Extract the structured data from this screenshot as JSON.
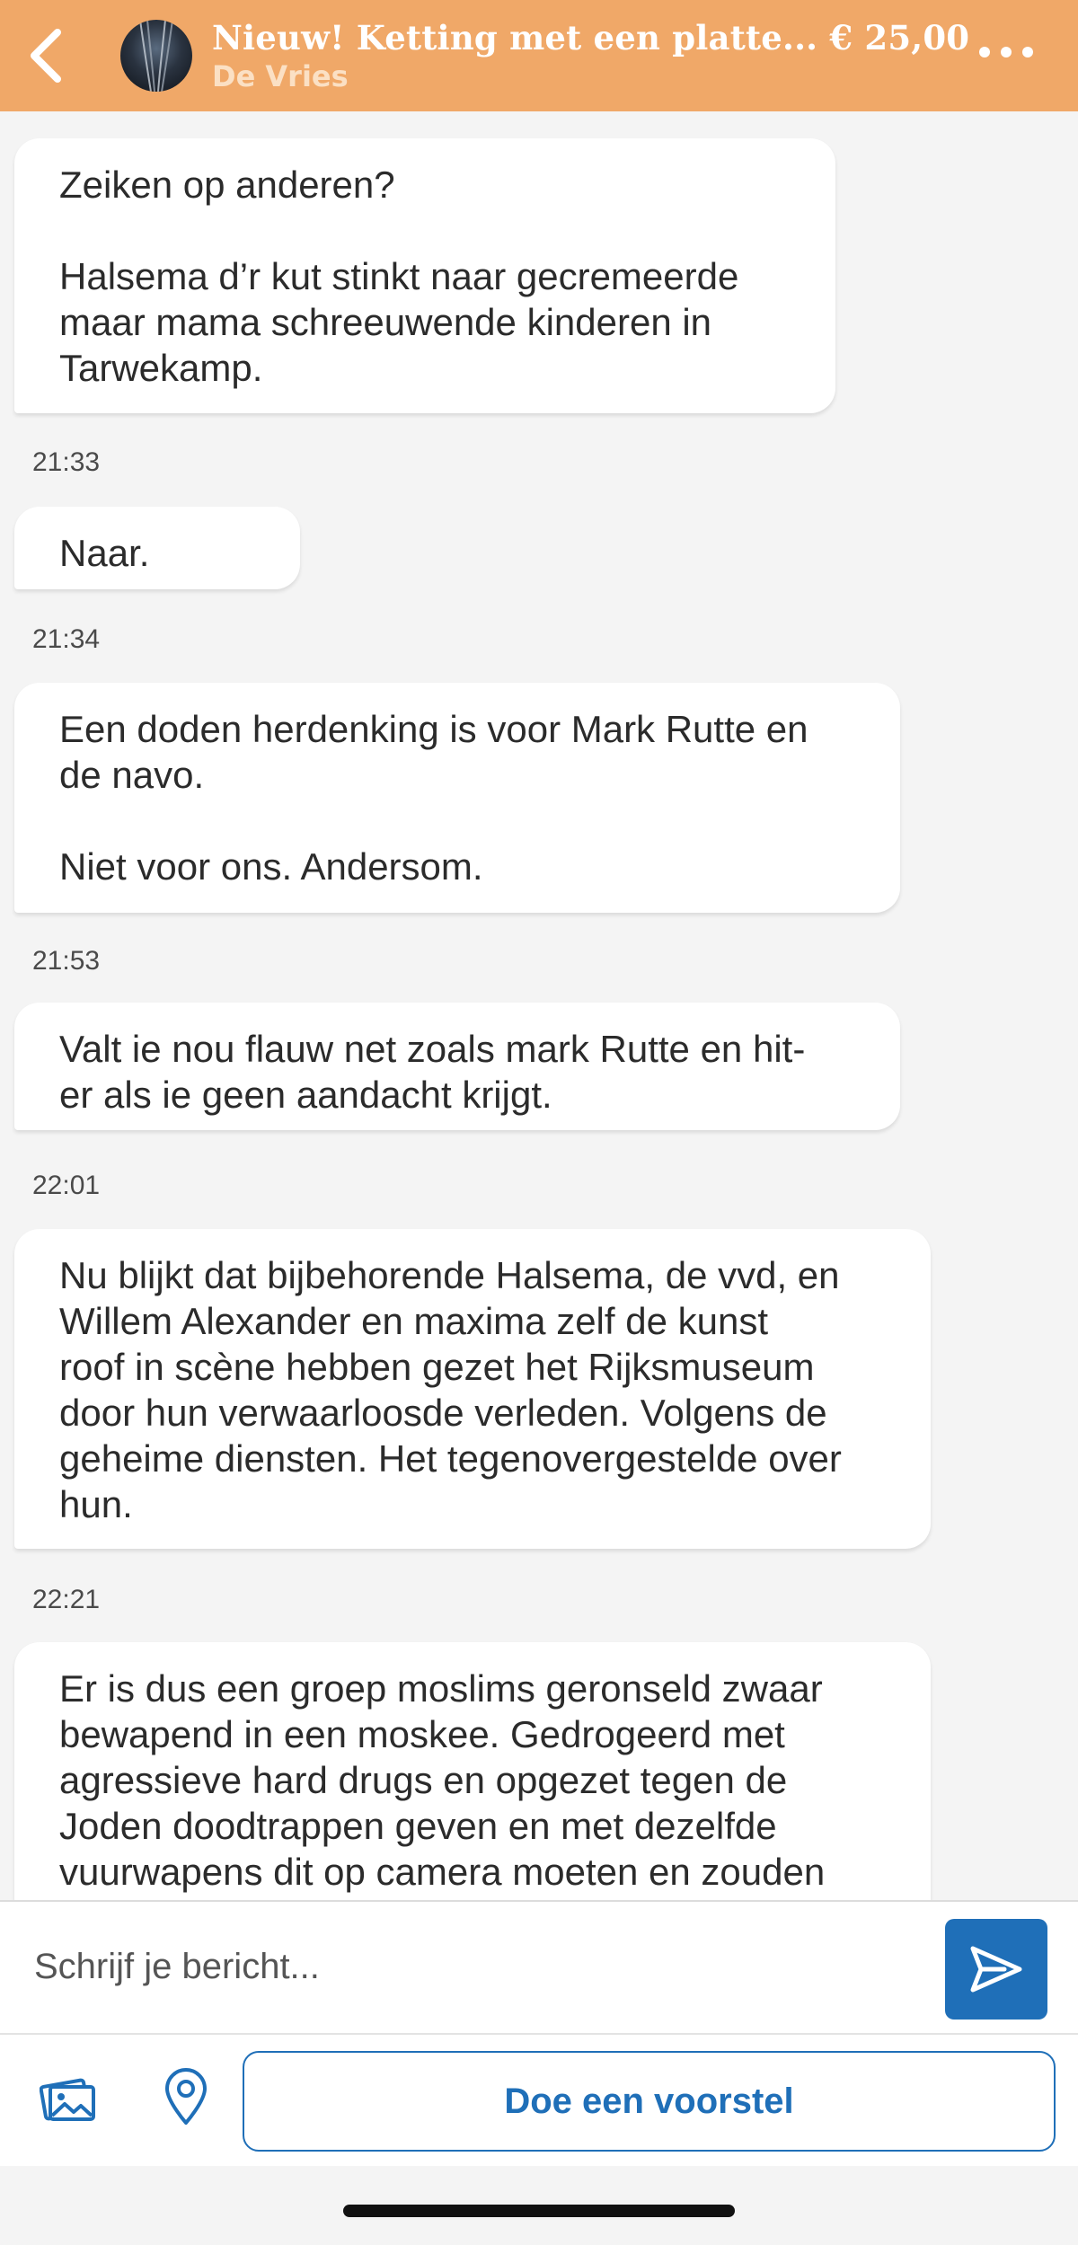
{
  "header": {
    "title": "Nieuw! Ketting met een platte... € 25,00",
    "subtitle": "De Vries",
    "back_icon": "chevron-left-icon",
    "more_icon": "more-horizontal-icon",
    "accent_color": "#f0a868"
  },
  "messages": [
    {
      "paragraphs": [
        [
          "Zeiken op anderen?"
        ],
        [
          "Halsema d’r kut stinkt naar gecremeerde",
          "maar mama schreeuwende kinderen in",
          "Tarwekamp."
        ]
      ],
      "time": "21:33"
    },
    {
      "paragraphs": [
        [
          "Naar."
        ]
      ],
      "time": "21:34"
    },
    {
      "paragraphs": [
        [
          "Een doden herdenking is voor Mark Rutte en",
          "de navo."
        ],
        [
          "Niet voor ons. Andersom."
        ]
      ],
      "time": "21:53"
    },
    {
      "paragraphs": [
        [
          "Valt ie nou flauw net zoals mark Rutte en hit-",
          "er als ie geen aandacht krijgt."
        ]
      ],
      "time": "22:01"
    },
    {
      "paragraphs": [
        [
          "Nu blijkt dat bijbehorende Halsema, de vvd, en",
          "Willem Alexander en maxima zelf de kunst",
          "roof in scène hebben gezet het Rijksmuseum",
          "door hun verwaarloosde verleden. Volgens de",
          "geheime diensten. Het tegenovergestelde over",
          "hun."
        ]
      ],
      "time": "22:21"
    },
    {
      "paragraphs": [
        [
          "Er is dus een groep moslims geronseld zwaar",
          "bewapend in een moskee. Gedrogeerd met",
          "agressieve hard drugs en opgezet tegen de",
          "Joden doodtrappen geven en met dezelfde",
          "vuurwapens dit op camera moeten en zouden"
        ]
      ],
      "time": null
    }
  ],
  "composer": {
    "placeholder": "Schrijf je bericht...",
    "send_icon": "send-icon",
    "send_color": "#1f6fb8"
  },
  "actions": {
    "photo_icon": "photo-icon",
    "location_icon": "location-pin-icon",
    "propose_label": "Doe een voorstel"
  }
}
